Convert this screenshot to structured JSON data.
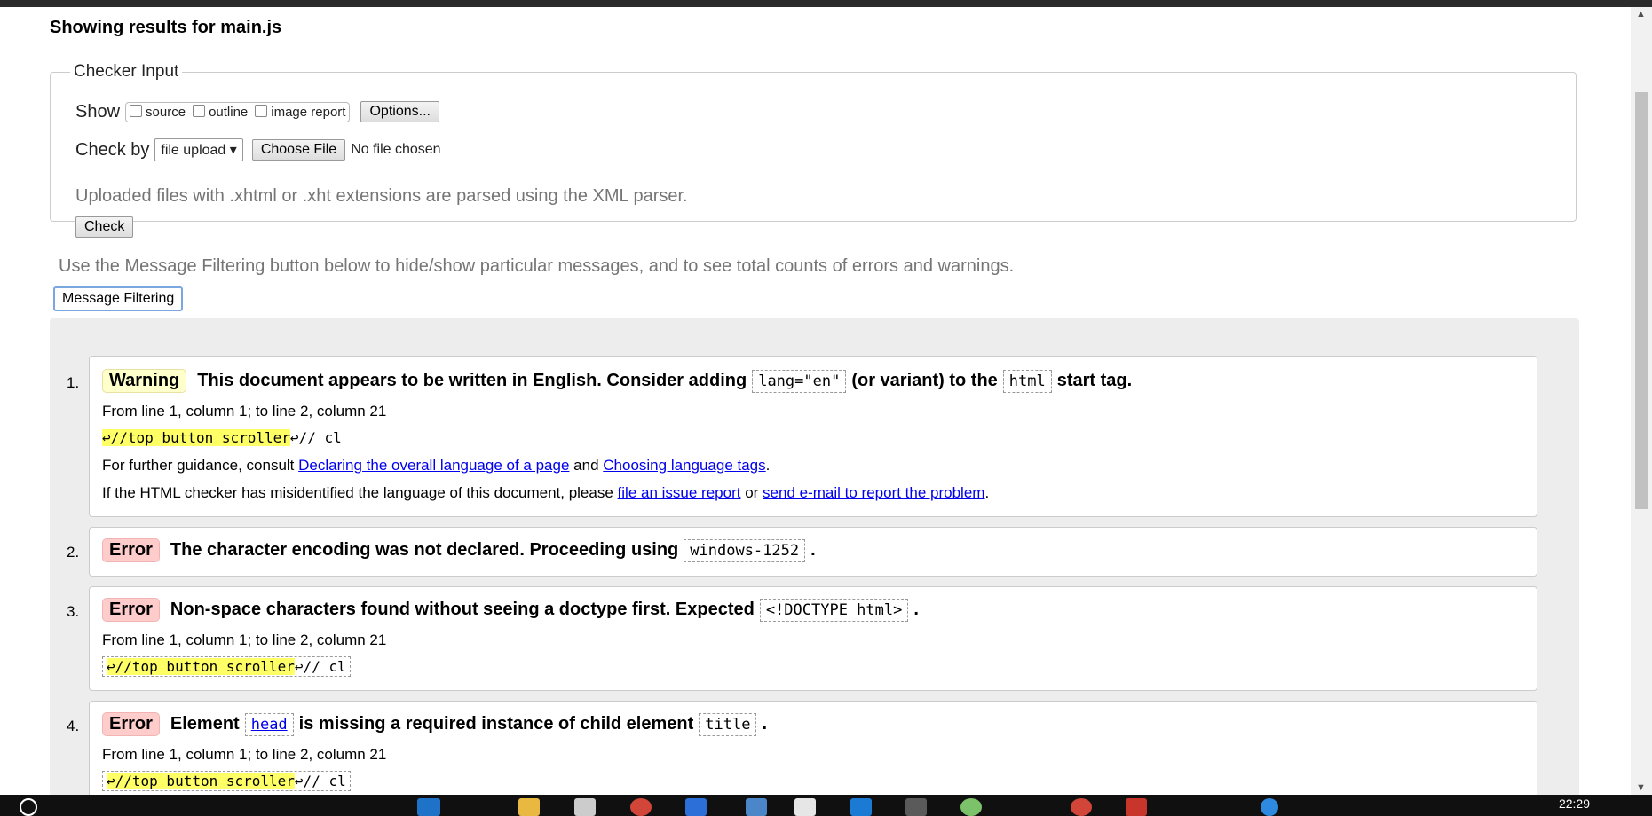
{
  "heading": "Showing results for main.js",
  "checker": {
    "legend": "Checker Input",
    "show_label": "Show",
    "show_options": [
      "source",
      "outline",
      "image report"
    ],
    "options_button": "Options...",
    "check_by_label": "Check by",
    "check_by_value": "file upload",
    "choose_file_button": "Choose File",
    "no_file_text": "No file chosen",
    "hint": "Uploaded files with .xhtml or .xht extensions are parsed using the XML parser.",
    "check_button": "Check"
  },
  "filter": {
    "text": "Use the Message Filtering button below to hide/show particular messages, and to see total counts of errors and warnings.",
    "button": "Message Filtering"
  },
  "messages": [
    {
      "number": "1.",
      "type": "Warning",
      "text_a": "This document appears to be written in English. Consider adding",
      "code_a": "lang=\"en\"",
      "text_b": "(or variant) to the",
      "code_b": "html",
      "text_c": "start tag.",
      "location": "From line 1, column 1; to line 2, column 21",
      "extract_hl": "↩//top button scroller",
      "extract_rest": "↩// cl",
      "guide_1_prefix": "For further guidance, consult",
      "guide_1_link1": "Declaring the overall language of a page",
      "guide_1_mid": "and",
      "guide_1_link2": "Choosing language tags",
      "guide_1_end": ".",
      "guide_2_prefix": "If the HTML checker has misidentified the language of this document, please",
      "guide_2_link1": "file an issue report",
      "guide_2_mid": "or",
      "guide_2_link2": "send e-mail to report the problem",
      "guide_2_end": "."
    },
    {
      "number": "2.",
      "type": "Error",
      "text_a": "The character encoding was not declared. Proceeding using",
      "code_a": "windows-1252",
      "text_b": "."
    },
    {
      "number": "3.",
      "type": "Error",
      "text_a": "Non-space characters found without seeing a doctype first. Expected",
      "code_a": "<!DOCTYPE html>",
      "text_b": ".",
      "location": "From line 1, column 1; to line 2, column 21",
      "extract_hl": "↩//top button scroller",
      "extract_rest": "↩// cl"
    },
    {
      "number": "4.",
      "type": "Error",
      "text_a": "Element",
      "code_a": "head",
      "text_b": "is missing a required instance of child element",
      "code_b": "title",
      "text_c": ".",
      "location": "From line 1, column 1; to line 2, column 21",
      "extract_hl": "↩//top button scroller",
      "extract_rest": "↩// cl"
    }
  ],
  "taskbar": {
    "clock": "22:29"
  },
  "colors": {
    "warning_badge": "#ffffcc",
    "error_badge": "#ffcccc",
    "highlight": "#ffff66",
    "link": "#0000ee"
  }
}
